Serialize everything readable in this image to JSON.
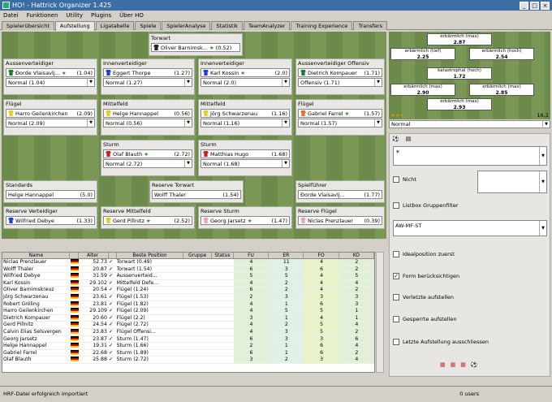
{
  "window": {
    "title": "HO! - Hattrick Organizer 1.425"
  },
  "menu": [
    "Datei",
    "Funktionen",
    "Utility",
    "Plugins",
    "Über HO"
  ],
  "tabs": [
    "Spielerübersicht",
    "Aufstellung",
    "Ligatabelle",
    "Spiele",
    "SpielerAnalyse",
    "Statistik",
    "TeamAnalyzer",
    "Training Experience",
    "Transfers"
  ],
  "lineup": {
    "torwart": {
      "title": "Torwart",
      "player": "Oliver Barnimsk...",
      "rating": "(0.52)"
    },
    "av1": {
      "title": "Aussenverteidiger",
      "player": "Đorde Vlaisavlj...",
      "rating": "(1.04)",
      "sel": "Normal (1.04)"
    },
    "iv1": {
      "title": "Innenverteidiger",
      "player": "Eggert Thorpe",
      "rating": "(1.27)",
      "sel": "Normal (1.27)"
    },
    "iv2": {
      "title": "Innenverteidiger",
      "player": "Karl Kossin",
      "rating": "(2.0)",
      "sel": "Normal (2.0)"
    },
    "av2": {
      "title": "Aussenverteidiger Offensiv",
      "player": "Dietrich Kompauer",
      "rating": "(1.71)",
      "sel": "Offensiv (1.71)"
    },
    "fl1": {
      "title": "Flügel",
      "player": "Harro Geilenkirchen",
      "rating": "(2.09)",
      "sel": "Normal (2.09)"
    },
    "mf1": {
      "title": "Mittelfeld",
      "player": "Helge Hannappel",
      "rating": "(0.56)",
      "sel": "Normal (0.56)"
    },
    "mf2": {
      "title": "Mittelfeld",
      "player": "Jörg Schwarzenau",
      "rating": "(1.16)",
      "sel": "Normal (1.16)"
    },
    "fl2": {
      "title": "Flügel",
      "player": "Gabriel Farrel",
      "rating": "(1.57)",
      "sel": "Normal (1.57)"
    },
    "st1": {
      "title": "Sturm",
      "player": "Olaf Blauth",
      "rating": "(2.72)",
      "sel": "Normal (2.72)"
    },
    "st2": {
      "title": "Sturm",
      "player": "Matthias Hugo",
      "rating": "(1.68)",
      "sel": "Normal (1.68)"
    },
    "standards": {
      "title": "Standards",
      "player": "Helge Hannappel",
      "rating": "(5.0)"
    },
    "restw": {
      "title": "Reserve Torwart",
      "player": "Wolff Thaler",
      "rating": "(1.54)"
    },
    "captain": {
      "title": "Spielführer",
      "player": "Đorde Vlaisavlj...",
      "rating": "(1.77)"
    },
    "resv": {
      "title": "Reserve Verteidiger",
      "player": "Wilfried Debye",
      "rating": "(1.33)"
    },
    "resm": {
      "title": "Reserve Mittelfeld",
      "player": "Gerd Pillnitz",
      "rating": "(2.52)"
    },
    "ress": {
      "title": "Reserve Sturm",
      "player": "Georg Jarsetz",
      "rating": "(1.47)"
    },
    "resf": {
      "title": "Reserve Flügel",
      "player": "Niclas Prenzlauer",
      "rating": "(0.39)"
    }
  },
  "ratings": {
    "top": {
      "label": "erbärmlich (max)",
      "val": "2.87"
    },
    "l1": {
      "label": "erbärmlich (tief)",
      "val": "2.25"
    },
    "r1": {
      "label": "erbärmlich (hoch)",
      "val": "2.54"
    },
    "mid": {
      "label": "katastrophal (hoch)",
      "val": "1.72"
    },
    "l2": {
      "label": "erbärmlich (max)",
      "val": "2.90"
    },
    "r2": {
      "label": "erbärmlich (max)",
      "val": "2.85"
    },
    "bot": {
      "label": "erbärmlich (max)",
      "val": "2.93"
    },
    "hatstats": "16,1",
    "style": "Normal"
  },
  "options": {
    "nicht": "Nicht",
    "listbox": "Listbox Gruppenfilter",
    "formation": "AW-MF-ST",
    "ideal": "Idealposition zuerst",
    "form": "Form berücksichtigen",
    "verletzte": "Verletzte aufstellen",
    "gesperrte": "Gesperrte aufstellen",
    "letzte": "Letzte Aufstellung ausschliessen"
  },
  "table": {
    "headers": [
      "Name",
      "",
      "Alter",
      "",
      "Beste Position",
      "Gruppe",
      "Status",
      "FÜ",
      "ER",
      "FO",
      "KO"
    ],
    "rows": [
      {
        "name": "Niclas Prenzlauer",
        "age": "52.73",
        "pos": "Torwart (0.49)",
        "fu": "4",
        "er": "11",
        "fo": "4",
        "ko": "2"
      },
      {
        "name": "Wolff Thaler",
        "age": "20.87",
        "pos": "Torwart (1.54)",
        "fu": "6",
        "er": "3",
        "fo": "6",
        "ko": "2"
      },
      {
        "name": "Wilfried Debye",
        "age": "31.59",
        "pos": "Aussenverteid...",
        "fu": "5",
        "er": "5",
        "fo": "4",
        "ko": "5"
      },
      {
        "name": "Karl Kossin",
        "age": "29.102",
        "pos": "Mittelfeld Defe...",
        "fu": "4",
        "er": "2",
        "fo": "4",
        "ko": "4"
      },
      {
        "name": "Oliver Barnimskreuz",
        "age": "20.54",
        "pos": "Flügel (1.24)",
        "fu": "6",
        "er": "2",
        "fo": "4",
        "ko": "2"
      },
      {
        "name": "Jörg Schwarzenau",
        "age": "23.61",
        "pos": "Flügel (1.53)",
        "fu": "2",
        "er": "3",
        "fo": "3",
        "ko": "3"
      },
      {
        "name": "Robert Gröling",
        "age": "23.81",
        "pos": "Flügel (1.82)",
        "fu": "4",
        "er": "1",
        "fo": "6",
        "ko": "3"
      },
      {
        "name": "Harro Geilenkirchen",
        "age": "29.109",
        "pos": "Flügel (2.09)",
        "fu": "4",
        "er": "5",
        "fo": "5",
        "ko": "1"
      },
      {
        "name": "Dietrich Kompauer",
        "age": "20.60",
        "pos": "Flügel (2.2)",
        "fu": "3",
        "er": "1",
        "fo": "4",
        "ko": "1"
      },
      {
        "name": "Gerd Pillnitz",
        "age": "24.54",
        "pos": "Flügel (2.72)",
        "fu": "4",
        "er": "2",
        "fo": "5",
        "ko": "4"
      },
      {
        "name": "Calvin Elias Selsvergen",
        "age": "23.83",
        "pos": "Flügel Offensi...",
        "fu": "4",
        "er": "3",
        "fo": "5",
        "ko": "2"
      },
      {
        "name": "Georg Jarsetz",
        "age": "23.87",
        "pos": "Sturm (1.47)",
        "fu": "6",
        "er": "3",
        "fo": "3",
        "ko": "6"
      },
      {
        "name": "Helge Hannappel",
        "age": "19.31",
        "pos": "Sturm (1.66)",
        "fu": "2",
        "er": "1",
        "fo": "6",
        "ko": "4"
      },
      {
        "name": "Gabriel Farrel",
        "age": "22.68",
        "pos": "Sturm (1.89)",
        "fu": "6",
        "er": "1",
        "fo": "6",
        "ko": "2"
      },
      {
        "name": "Olaf Blauth",
        "age": "25.88",
        "pos": "Sturm (2.72)",
        "fu": "3",
        "er": "2",
        "fo": "3",
        "ko": "4"
      }
    ]
  },
  "status": {
    "message": "HRF-Datei erfolgreich importiert",
    "users": "0 users"
  }
}
